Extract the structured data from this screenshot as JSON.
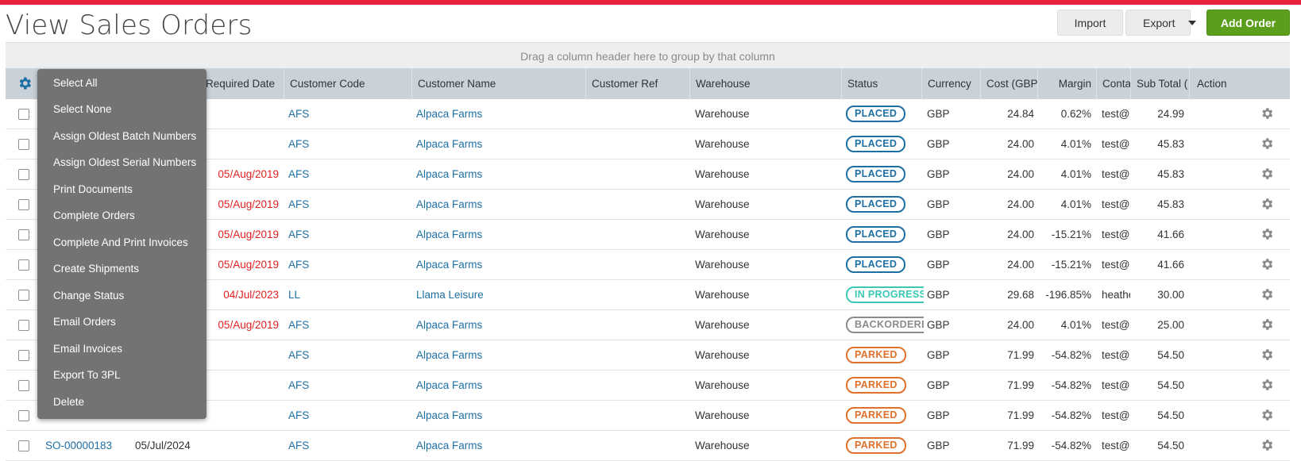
{
  "page": {
    "title": "View Sales Orders"
  },
  "toolbar": {
    "import_label": "Import",
    "export_label": "Export",
    "add_label": "Add Order"
  },
  "grid": {
    "group_hint": "Drag a column header here to group by that column",
    "columns": {
      "required_date": "Required Date",
      "customer_code": "Customer Code",
      "customer_name": "Customer Name",
      "customer_ref": "Customer Ref",
      "warehouse": "Warehouse",
      "status": "Status",
      "currency": "Currency",
      "cost": "Cost (GBP",
      "margin": "Margin",
      "contact": "Conta",
      "subtotal": "Sub Total (",
      "action": "Action"
    },
    "rows": [
      {
        "order": "",
        "order_date": "",
        "required": "",
        "code": "AFS",
        "name": "Alpaca Farms",
        "ref": "",
        "warehouse": "Warehouse",
        "status": "PLACED",
        "currency": "GBP",
        "cost": "24.84",
        "margin": "0.62%",
        "contact": "test@u",
        "subtotal": "24.99"
      },
      {
        "order": "",
        "order_date": "",
        "required": "",
        "code": "AFS",
        "name": "Alpaca Farms",
        "ref": "",
        "warehouse": "Warehouse",
        "status": "PLACED",
        "currency": "GBP",
        "cost": "24.00",
        "margin": "4.01%",
        "contact": "test@u",
        "subtotal": "45.83"
      },
      {
        "order": "",
        "order_date": "",
        "required": "05/Aug/2019",
        "code": "AFS",
        "name": "Alpaca Farms",
        "ref": "",
        "warehouse": "Warehouse",
        "status": "PLACED",
        "currency": "GBP",
        "cost": "24.00",
        "margin": "4.01%",
        "contact": "test@u",
        "subtotal": "45.83"
      },
      {
        "order": "",
        "order_date": "",
        "required": "05/Aug/2019",
        "code": "AFS",
        "name": "Alpaca Farms",
        "ref": "",
        "warehouse": "Warehouse",
        "status": "PLACED",
        "currency": "GBP",
        "cost": "24.00",
        "margin": "4.01%",
        "contact": "test@u",
        "subtotal": "45.83"
      },
      {
        "order": "",
        "order_date": "",
        "required": "05/Aug/2019",
        "code": "AFS",
        "name": "Alpaca Farms",
        "ref": "",
        "warehouse": "Warehouse",
        "status": "PLACED",
        "currency": "GBP",
        "cost": "24.00",
        "margin": "-15.21%",
        "contact": "test@u",
        "subtotal": "41.66"
      },
      {
        "order": "",
        "order_date": "",
        "required": "05/Aug/2019",
        "code": "AFS",
        "name": "Alpaca Farms",
        "ref": "",
        "warehouse": "Warehouse",
        "status": "PLACED",
        "currency": "GBP",
        "cost": "24.00",
        "margin": "-15.21%",
        "contact": "test@u",
        "subtotal": "41.66"
      },
      {
        "order": "",
        "order_date": "",
        "required": "04/Jul/2023",
        "code": "LL",
        "name": "Llama Leisure",
        "ref": "",
        "warehouse": "Warehouse",
        "status": "IN PROGRESS",
        "currency": "GBP",
        "cost": "29.68",
        "margin": "-196.85%",
        "contact": "heathe",
        "subtotal": "30.00"
      },
      {
        "order": "",
        "order_date": "",
        "required": "05/Aug/2019",
        "code": "AFS",
        "name": "Alpaca Farms",
        "ref": "",
        "warehouse": "Warehouse",
        "status": "BACKORDERED",
        "currency": "GBP",
        "cost": "24.00",
        "margin": "4.01%",
        "contact": "test@u",
        "subtotal": "25.00"
      },
      {
        "order": "",
        "order_date": "",
        "required": "",
        "code": "AFS",
        "name": "Alpaca Farms",
        "ref": "",
        "warehouse": "Warehouse",
        "status": "PARKED",
        "currency": "GBP",
        "cost": "71.99",
        "margin": "-54.82%",
        "contact": "test@u",
        "subtotal": "54.50"
      },
      {
        "order": "",
        "order_date": "",
        "required": "",
        "code": "AFS",
        "name": "Alpaca Farms",
        "ref": "",
        "warehouse": "Warehouse",
        "status": "PARKED",
        "currency": "GBP",
        "cost": "71.99",
        "margin": "-54.82%",
        "contact": "test@u",
        "subtotal": "54.50"
      },
      {
        "order": "",
        "order_date": "",
        "required": "",
        "code": "AFS",
        "name": "Alpaca Farms",
        "ref": "",
        "warehouse": "Warehouse",
        "status": "PARKED",
        "currency": "GBP",
        "cost": "71.99",
        "margin": "-54.82%",
        "contact": "test@u",
        "subtotal": "54.50"
      },
      {
        "order": "SO-00000183",
        "order_date": "05/Jul/2024",
        "required": "",
        "code": "AFS",
        "name": "Alpaca Farms",
        "ref": "",
        "warehouse": "Warehouse",
        "status": "PARKED",
        "currency": "GBP",
        "cost": "71.99",
        "margin": "-54.82%",
        "contact": "test@u",
        "subtotal": "54.50"
      }
    ]
  },
  "bulk_menu": {
    "items": [
      "Select All",
      "Select None",
      "Assign Oldest Batch Numbers",
      "Assign Oldest Serial Numbers",
      "Print Documents",
      "Complete Orders",
      "Complete And Print Invoices",
      "Create Shipments",
      "Change Status",
      "Email Orders",
      "Email Invoices",
      "Export To 3PL",
      "Delete"
    ]
  },
  "status_colors": {
    "PLACED": "#1e6fa3",
    "IN PROGRESS": "#3cc9b4",
    "BACKORDERED": "#8c8c8c",
    "PARKED": "#e0702a"
  },
  "icons": {
    "header_settings": "gear-icon",
    "row_action": "gear-icon",
    "export_dropdown": "chevron-down-icon"
  }
}
